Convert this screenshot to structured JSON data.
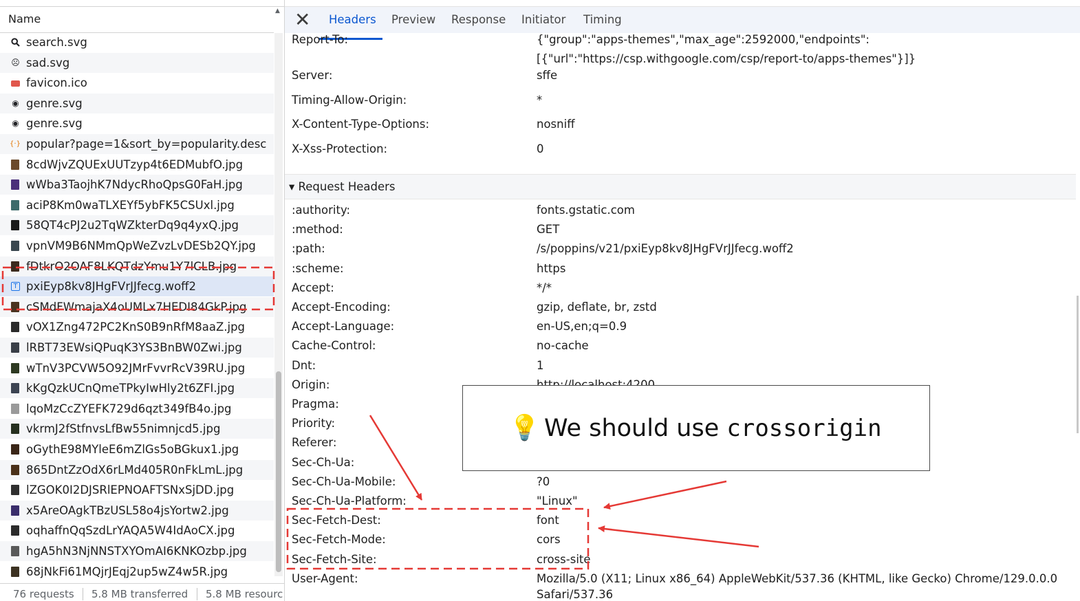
{
  "left_pane": {
    "header": "Name",
    "files": [
      {
        "name": "search.svg",
        "icon": "search-icon",
        "color": "#202124"
      },
      {
        "name": "sad.svg",
        "icon": "sad-face-icon",
        "color": "#202124"
      },
      {
        "name": "favicon.ico",
        "icon": "favicon-icon",
        "color": "#e0574c"
      },
      {
        "name": "genre.svg",
        "icon": "record-icon",
        "color": "#202124"
      },
      {
        "name": "genre.svg",
        "icon": "record-icon",
        "color": "#202124"
      },
      {
        "name": "popular?page=1&sort_by=popularity.desc",
        "icon": "json-icon",
        "color": "#e37400"
      },
      {
        "name": "8cdWjvZQUExUUTzyp4t6EDMubfO.jpg",
        "icon": "image-thumbnail-icon",
        "color": "#6b4a2b"
      },
      {
        "name": "wWba3TaojhK7NdycRhoQpsG0FaH.jpg",
        "icon": "image-thumbnail-icon",
        "color": "#4b2f7a"
      },
      {
        "name": "aciP8Km0waTLXEYf5ybFK5CSUxl.jpg",
        "icon": "image-thumbnail-icon",
        "color": "#3d6b6b"
      },
      {
        "name": "58QT4cPJ2u2TqWZkterDq9q4yxQ.jpg",
        "icon": "image-thumbnail-icon",
        "color": "#1a1a1a"
      },
      {
        "name": "vpnVM9B6NMmQpWeZvzLvDESb2QY.jpg",
        "icon": "image-thumbnail-icon",
        "color": "#39474f"
      },
      {
        "name": "fDtkrO2OAF8LKQTdzYmu1Y7lCLB.jpg",
        "icon": "image-thumbnail-icon",
        "color": "#3b2a1e"
      },
      {
        "name": "pxiEyp8kv8JHgFVrJJfecg.woff2",
        "icon": "font-file-icon",
        "color": "#1a73e8"
      },
      {
        "name": "cSMdFWmajaX4oUMLx7HEDI84GkP.jpg",
        "icon": "image-thumbnail-icon",
        "color": "#4a3320"
      },
      {
        "name": "vOX1Zng472PC2KnS0B9nRfM8aaZ.jpg",
        "icon": "image-thumbnail-icon",
        "color": "#2a2a2a"
      },
      {
        "name": "lRBT73EWsiQPuqK3YS3BnBW0Zwi.jpg",
        "icon": "image-thumbnail-icon",
        "color": "#3a3f48"
      },
      {
        "name": "wTnV3PCVW5O92JMrFvvrRcV39RU.jpg",
        "icon": "image-thumbnail-icon",
        "color": "#2e3a22"
      },
      {
        "name": "kKgQzkUCnQmeTPkyIwHly2t6ZFI.jpg",
        "icon": "image-thumbnail-icon",
        "color": "#3c4452"
      },
      {
        "name": "lqoMzCcZYEFK729d6qzt349fB4o.jpg",
        "icon": "image-thumbnail-icon",
        "color": "#9a9a9a"
      },
      {
        "name": "vkrmJ2fStfnvsLfBw55nimnjcd5.jpg",
        "icon": "image-thumbnail-icon",
        "color": "#26301f"
      },
      {
        "name": "oGythE98MYleE6mZlGs5oBGkux1.jpg",
        "icon": "image-thumbnail-icon",
        "color": "#3a2617"
      },
      {
        "name": "865DntZzOdX6rLMd405R0nFkLmL.jpg",
        "icon": "image-thumbnail-icon",
        "color": "#4b3119"
      },
      {
        "name": "lZGOK0I2DJSRlEPNOAFTSNxSjDD.jpg",
        "icon": "image-thumbnail-icon",
        "color": "#2f2f2f"
      },
      {
        "name": "x5AreOAgkTBzUSL58o4jsYortw2.jpg",
        "icon": "image-thumbnail-icon",
        "color": "#3a2d6b"
      },
      {
        "name": "oqhaffnQqSzdLrYAQA5W4IdAoCX.jpg",
        "icon": "image-thumbnail-icon",
        "color": "#2b2b2b"
      },
      {
        "name": "hgA5hN3NjNNSTXYOmAI6KNKOzbp.jpg",
        "icon": "image-thumbnail-icon",
        "color": "#5a5a5a"
      },
      {
        "name": "68jNkFi61MQjrJEqj2up5wZ4w5R.jpg",
        "icon": "image-thumbnail-icon",
        "color": "#3c3222"
      }
    ],
    "selected_file_index": 12,
    "status": {
      "requests": "76 requests",
      "transferred": "5.8 MB transferred",
      "resources": "5.8 MB resourc"
    }
  },
  "details_pane": {
    "close_icon": "close-icon",
    "tabs": [
      "Headers",
      "Preview",
      "Response",
      "Initiator",
      "Timing"
    ],
    "active_tab": "Headers",
    "response_headers": [
      {
        "name": "Report-To:",
        "value": "{\"group\":\"apps-themes\",\"max_age\":2592000,\"endpoints\":",
        "value2": "[{\"url\":\"https://csp.withgoogle.com/csp/report-to/apps-themes\"}]}"
      },
      {
        "name": "Server:",
        "value": "sffe"
      },
      {
        "name": "Timing-Allow-Origin:",
        "value": "*"
      },
      {
        "name": "X-Content-Type-Options:",
        "value": "nosniff"
      },
      {
        "name": "X-Xss-Protection:",
        "value": "0"
      }
    ],
    "request_section_title": "Request Headers",
    "request_headers": [
      {
        "name": ":authority:",
        "value": "fonts.gstatic.com"
      },
      {
        "name": ":method:",
        "value": "GET"
      },
      {
        "name": ":path:",
        "value": "/s/poppins/v21/pxiEyp8kv8JHgFVrJJfecg.woff2"
      },
      {
        "name": ":scheme:",
        "value": "https"
      },
      {
        "name": "Accept:",
        "value": "*/*"
      },
      {
        "name": "Accept-Encoding:",
        "value": "gzip, deflate, br, zstd"
      },
      {
        "name": "Accept-Language:",
        "value": "en-US,en;q=0.9"
      },
      {
        "name": "Cache-Control:",
        "value": "no-cache"
      },
      {
        "name": "Dnt:",
        "value": "1"
      },
      {
        "name": "Origin:",
        "value": "http://localhost:4200"
      },
      {
        "name": "Pragma:",
        "value": ""
      },
      {
        "name": "Priority:",
        "value": ""
      },
      {
        "name": "Referer:",
        "value": ""
      },
      {
        "name": "Sec-Ch-Ua:",
        "value": ""
      },
      {
        "name": "Sec-Ch-Ua-Mobile:",
        "value": "?0"
      },
      {
        "name": "Sec-Ch-Ua-Platform:",
        "value": "\"Linux\""
      },
      {
        "name": "Sec-Fetch-Dest:",
        "value": "font"
      },
      {
        "name": "Sec-Fetch-Mode:",
        "value": "cors"
      },
      {
        "name": "Sec-Fetch-Site:",
        "value": "cross-site"
      },
      {
        "name": "User-Agent:",
        "value": "Mozilla/5.0 (X11; Linux x86_64) AppleWebKit/537.36 (KHTML, like Gecko) Chrome/129.0.0.0",
        "value2": "Safari/537.36"
      }
    ]
  },
  "callout": {
    "icon": "lightbulb-icon",
    "text": "We should use ",
    "code": "crossorigin"
  },
  "annotation_color": "#e53935"
}
